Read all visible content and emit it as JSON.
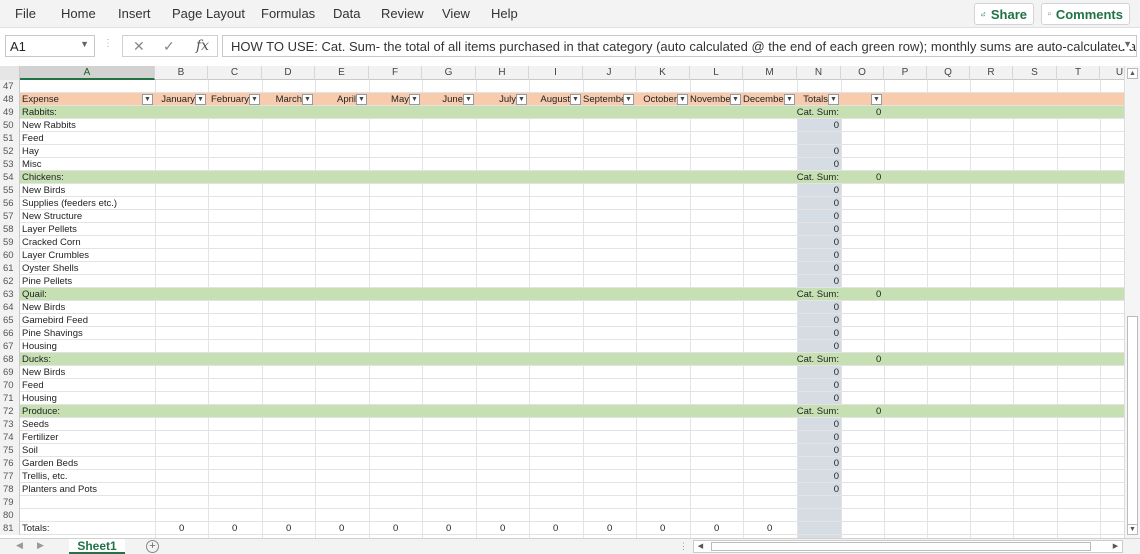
{
  "menu": [
    "File",
    "Home",
    "Insert",
    "Page Layout",
    "Formulas",
    "Data",
    "Review",
    "View",
    "Help"
  ],
  "share_label": "Share",
  "comments_label": "Comments",
  "name_box": "A1",
  "formula_text": "HOW TO USE: Cat. Sum- the total of all items purchased in that category (auto calculated @ the end of each green row); monthly sums are auto-calculated at the",
  "columns": [
    "A",
    "B",
    "C",
    "D",
    "E",
    "F",
    "G",
    "H",
    "I",
    "J",
    "K",
    "L",
    "M",
    "N",
    "O",
    "P",
    "Q",
    "R",
    "S",
    "T",
    "U"
  ],
  "header_row": {
    "num": "48",
    "expense": "Expense",
    "months": [
      "January",
      "February",
      "March",
      "April",
      "May",
      "June",
      "July",
      "August",
      "September",
      "October",
      "November",
      "December"
    ],
    "totals": "Totals"
  },
  "rows": [
    {
      "num": "47",
      "type": "blank",
      "label": "",
      "n": "",
      "o": ""
    },
    {
      "num": "49",
      "type": "cat",
      "label": "Rabbits:",
      "n": "Cat. Sum:",
      "o": "0"
    },
    {
      "num": "50",
      "type": "item",
      "label": "New Rabbits",
      "n": "0",
      "o": ""
    },
    {
      "num": "51",
      "type": "item",
      "label": "Feed",
      "n": "",
      "o": ""
    },
    {
      "num": "52",
      "type": "item",
      "label": "Hay",
      "n": "0",
      "o": ""
    },
    {
      "num": "53",
      "type": "item",
      "label": "Misc",
      "n": "0",
      "o": ""
    },
    {
      "num": "54",
      "type": "cat",
      "label": "Chickens:",
      "n": "Cat. Sum:",
      "o": "0"
    },
    {
      "num": "55",
      "type": "item",
      "label": "New Birds",
      "n": "0",
      "o": ""
    },
    {
      "num": "56",
      "type": "item",
      "label": "Supplies (feeders etc.)",
      "n": "0",
      "o": ""
    },
    {
      "num": "57",
      "type": "item",
      "label": "New Structure",
      "n": "0",
      "o": ""
    },
    {
      "num": "58",
      "type": "item",
      "label": "Layer Pellets",
      "n": "0",
      "o": ""
    },
    {
      "num": "59",
      "type": "item",
      "label": "Cracked Corn",
      "n": "0",
      "o": ""
    },
    {
      "num": "60",
      "type": "item",
      "label": "Layer Crumbles",
      "n": "0",
      "o": ""
    },
    {
      "num": "61",
      "type": "item",
      "label": "Oyster Shells",
      "n": "0",
      "o": ""
    },
    {
      "num": "62",
      "type": "item",
      "label": "Pine Pellets",
      "n": "0",
      "o": ""
    },
    {
      "num": "63",
      "type": "cat",
      "label": "Quail:",
      "n": "Cat. Sum:",
      "o": "0"
    },
    {
      "num": "64",
      "type": "item",
      "label": "New Birds",
      "n": "0",
      "o": ""
    },
    {
      "num": "65",
      "type": "item",
      "label": "Gamebird Feed",
      "n": "0",
      "o": ""
    },
    {
      "num": "66",
      "type": "item",
      "label": "Pine Shavings",
      "n": "0",
      "o": ""
    },
    {
      "num": "67",
      "type": "item",
      "label": "Housing",
      "n": "0",
      "o": ""
    },
    {
      "num": "68",
      "type": "cat",
      "label": "Ducks:",
      "n": "Cat. Sum:",
      "o": "0"
    },
    {
      "num": "69",
      "type": "item",
      "label": "New Birds",
      "n": "0",
      "o": ""
    },
    {
      "num": "70",
      "type": "item",
      "label": "Feed",
      "n": "0",
      "o": ""
    },
    {
      "num": "71",
      "type": "item",
      "label": "Housing",
      "n": "0",
      "o": ""
    },
    {
      "num": "72",
      "type": "cat",
      "label": "Produce:",
      "n": "Cat. Sum:",
      "o": "0"
    },
    {
      "num": "73",
      "type": "item",
      "label": "Seeds",
      "n": "0",
      "o": ""
    },
    {
      "num": "74",
      "type": "item",
      "label": "Fertilizer",
      "n": "0",
      "o": ""
    },
    {
      "num": "75",
      "type": "item",
      "label": "Soil",
      "n": "0",
      "o": ""
    },
    {
      "num": "76",
      "type": "item",
      "label": "Garden Beds",
      "n": "0",
      "o": ""
    },
    {
      "num": "77",
      "type": "item",
      "label": "Trellis, etc.",
      "n": "0",
      "o": ""
    },
    {
      "num": "78",
      "type": "item",
      "label": "Planters and Pots",
      "n": "0",
      "o": ""
    },
    {
      "num": "79",
      "type": "blank",
      "label": "",
      "n": "",
      "o": ""
    },
    {
      "num": "80",
      "type": "blank",
      "label": "",
      "n": "",
      "o": ""
    }
  ],
  "totals_row": {
    "num": "81",
    "label": "Totals:",
    "month_values": [
      "0",
      "0",
      "0",
      "0",
      "0",
      "0",
      "0",
      "0",
      "0",
      "0",
      "0",
      "0"
    ]
  },
  "sheet_tab": "Sheet1",
  "colors": {
    "header": "#f8cbad",
    "category": "#c6e0b4",
    "totals_col": "#d6dce4",
    "accent": "#217346"
  }
}
